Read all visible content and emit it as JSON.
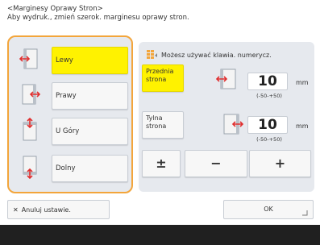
{
  "header": {
    "title": "<Marginesy Oprawy Stron>",
    "subtitle": "Aby wydruk., zmień szerok. marginesu oprawy stron."
  },
  "positions": [
    {
      "label": "Lewy",
      "selected": true
    },
    {
      "label": "Prawy",
      "selected": false
    },
    {
      "label": "U Góry",
      "selected": false
    },
    {
      "label": "Dolny",
      "selected": false
    }
  ],
  "hint": "Możesz używać klawia. numerycz.",
  "front": {
    "label": "Przednia strona",
    "value": "10",
    "unit": "mm",
    "range": "(-50-+50)"
  },
  "back": {
    "label": "Tylna strona",
    "value": "10",
    "unit": "mm",
    "range": "(-50-+50)"
  },
  "keys": {
    "plusminus": "±",
    "minus": "−",
    "plus": "+"
  },
  "footer": {
    "cancel_label": "Anuluj ustawie.",
    "ok_label": "OK"
  },
  "colors": {
    "accent_border": "#f3a53b",
    "selected": "#fff200",
    "panel": "#e6e9ee",
    "arrow": "#e03030"
  }
}
